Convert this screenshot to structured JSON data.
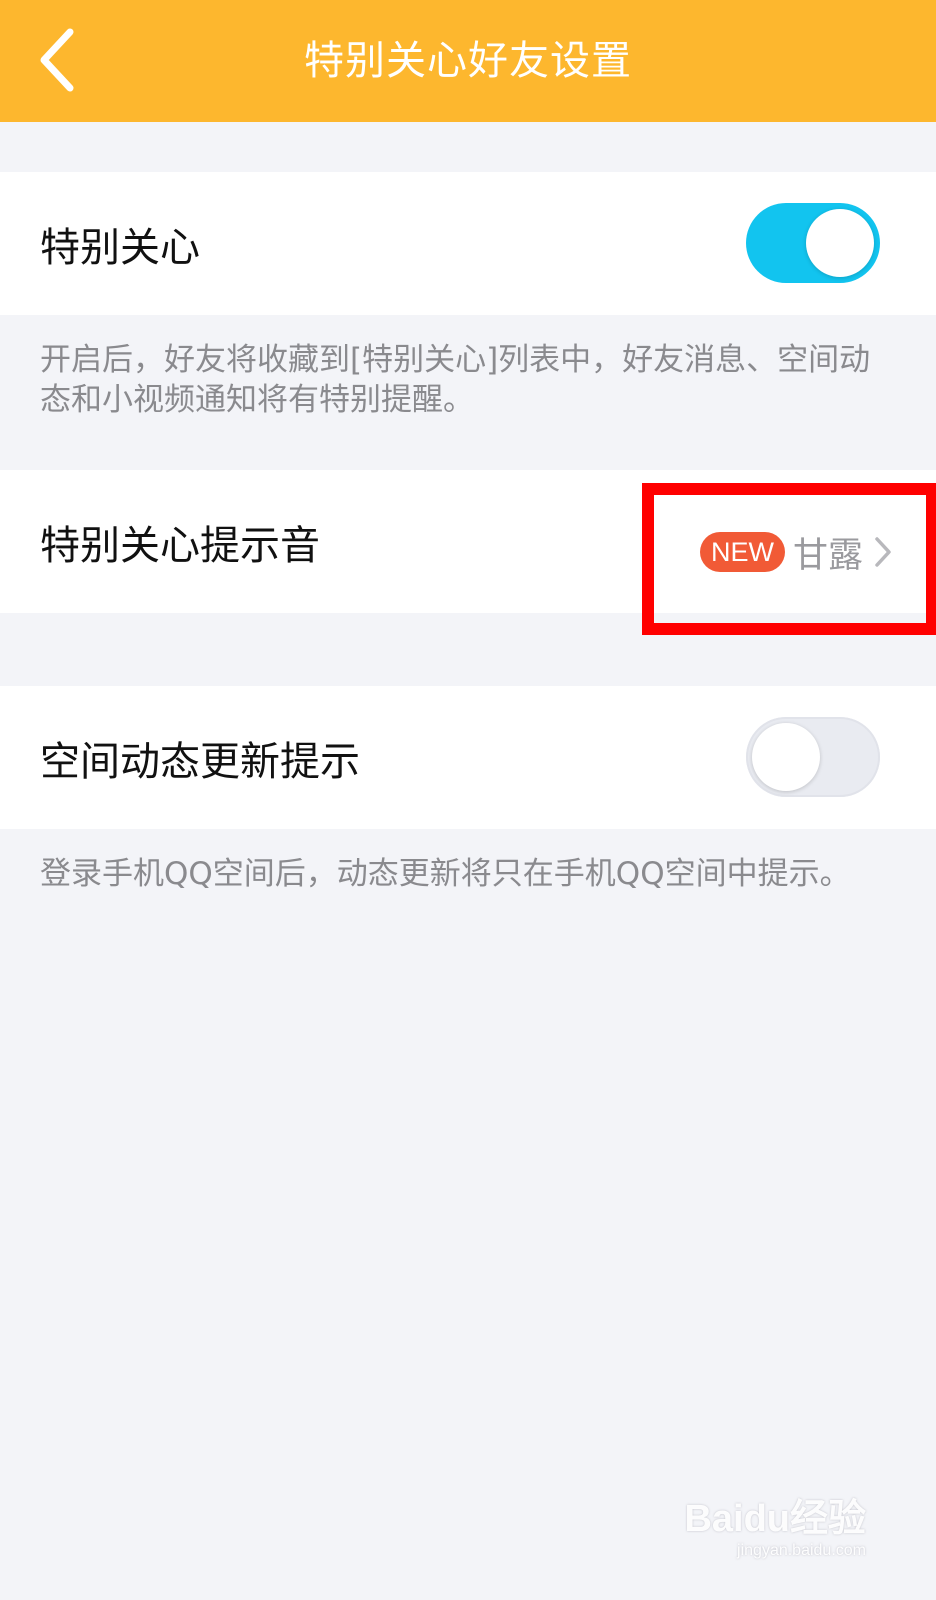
{
  "header": {
    "title": "特别关心好友设置",
    "back_icon": "chevron-left-icon",
    "background": "#fdb72e"
  },
  "settings": {
    "special_care": {
      "label": "特别关心",
      "enabled": true,
      "description": "开启后，好友将收藏到[特别关心]列表中，好友消息、空间动态和小视频通知将有特别提醒。"
    },
    "alert_sound": {
      "label": "特别关心提示音",
      "badge": "NEW",
      "value": "甘露",
      "chevron_icon": "chevron-right-icon"
    },
    "qzone_updates": {
      "label": "空间动态更新提示",
      "enabled": false,
      "description": "登录手机QQ空间后，动态更新将只在手机QQ空间中提示。"
    }
  },
  "colors": {
    "toggle_on": "#12c4ef",
    "badge": "#f15a36",
    "highlight": "#ff0000"
  },
  "watermark": {
    "brand": "Baidu经验",
    "url": "jingyan.baidu.com"
  }
}
